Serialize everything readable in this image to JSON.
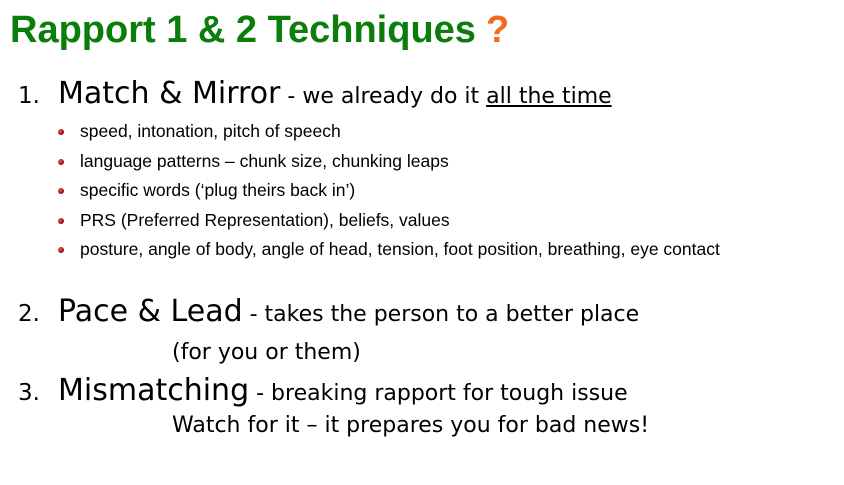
{
  "title": {
    "text": "Rapport 1 & 2 Techniques",
    "mark": "?"
  },
  "items": [
    {
      "number": "1.",
      "heading": "Match & Mirror",
      "desc_pre": " - we already do it ",
      "desc_underlined": "all the time",
      "bullets": [
        "speed, intonation, pitch of speech",
        "language patterns – chunk size, chunking leaps",
        "specific words (‘plug theirs back in’)",
        "PRS (Preferred Representation), beliefs, values",
        "posture, angle of body, angle of head, tension, foot position, breathing, eye contact"
      ]
    },
    {
      "number": "2.",
      "heading": "Pace & Lead",
      "desc_pre": " - takes the person to a better place",
      "sub": "(for you or them)"
    },
    {
      "number": "3.",
      "heading": "Mismatching",
      "desc_pre": " - breaking rapport for tough issue",
      "sub": "Watch for it – it prepares you for bad news!"
    }
  ],
  "colors": {
    "title": "#0a7d0a",
    "mark": "#f26b1d",
    "bullet": "#a01010",
    "text": "#000000"
  }
}
